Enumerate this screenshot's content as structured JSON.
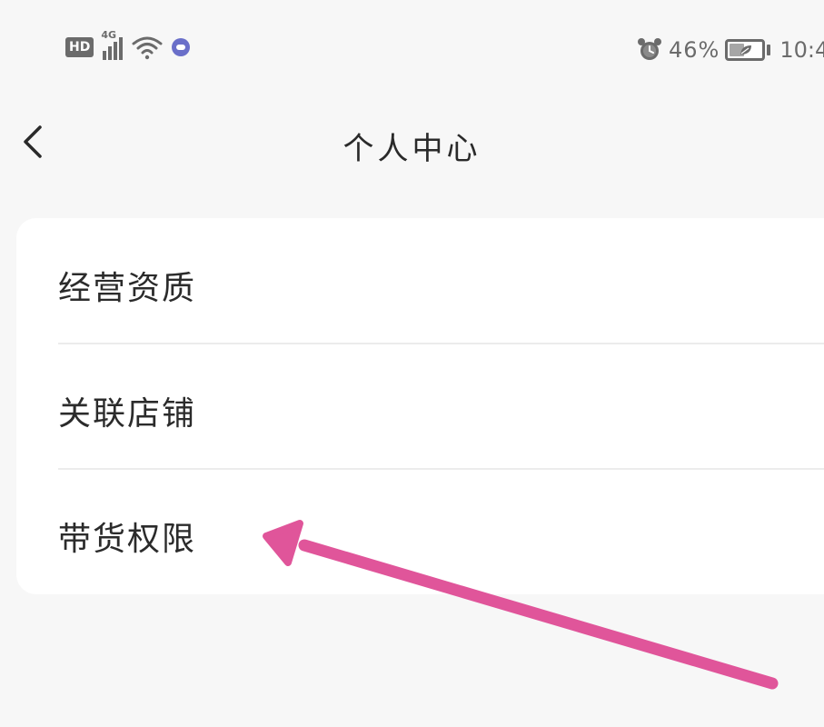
{
  "status_bar": {
    "hd_label": "HD",
    "network_label": "4G",
    "battery_percent": "46%",
    "battery_level": 0.46,
    "clock": "10:4",
    "icons": [
      "hd-icon",
      "signal-icon",
      "wifi-icon",
      "app-notification-icon",
      "alarm-icon",
      "battery-icon"
    ]
  },
  "nav": {
    "back_icon": "chevron-left-icon",
    "title": "个人中心"
  },
  "menu": {
    "items": [
      {
        "label": "经营资质"
      },
      {
        "label": "关联店铺"
      },
      {
        "label": "带货权限"
      }
    ]
  },
  "annotation": {
    "arrow_color": "#e0559a"
  },
  "colors": {
    "page_background": "#f7f7f7",
    "card_background": "#ffffff",
    "text_primary": "#2a2a2a",
    "status_gray": "#6b6b6b",
    "divider": "#ececec"
  }
}
